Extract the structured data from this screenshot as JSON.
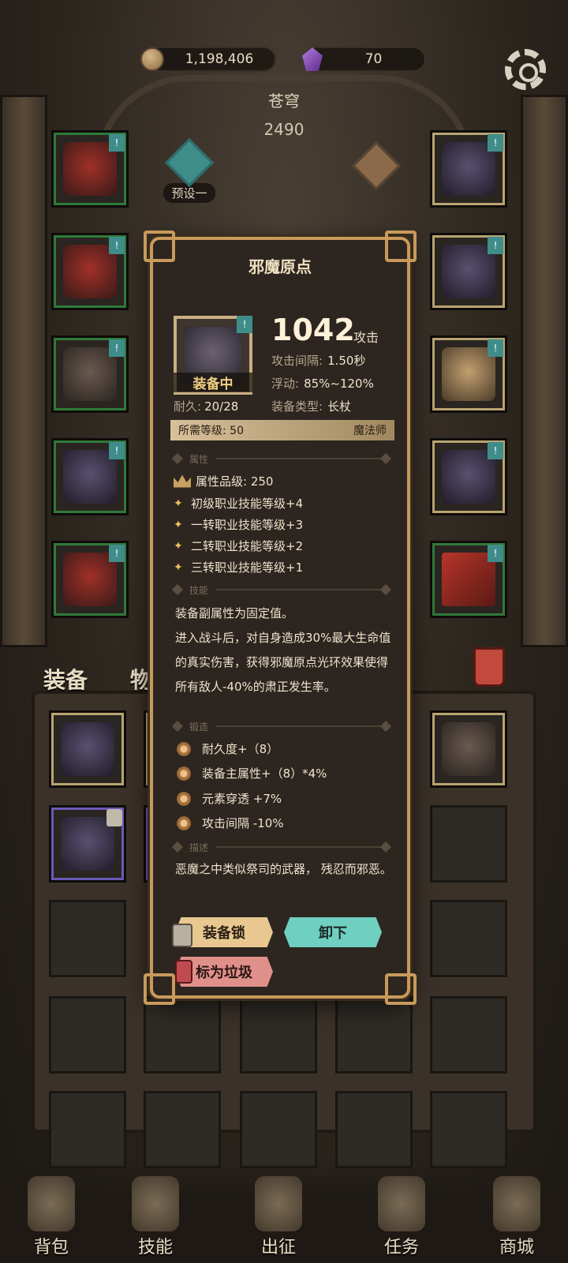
{
  "currency": {
    "gold": "1,198,406",
    "gems": "70"
  },
  "character": {
    "name": "苍穹",
    "power": "2490"
  },
  "preset": {
    "label": "预设一"
  },
  "bag_tabs": [
    "装备",
    "物品"
  ],
  "nav": [
    "背包",
    "技能",
    "出征",
    "任务",
    "商城"
  ],
  "item": {
    "name": "邪魔原点",
    "attack_value": "1042",
    "attack_label": "攻击",
    "equipped_label": "装备中",
    "durability_label": "耐久:",
    "durability_value": "20/28",
    "stats": [
      {
        "key": "攻击间隔:",
        "value": "1.50秒"
      },
      {
        "key": "浮动:",
        "value": "85%~120%"
      },
      {
        "key": "装备类型:",
        "value": "长杖"
      }
    ],
    "required_level": "所需等级: 50",
    "class": "魔法师",
    "tag_symbol": "!",
    "sections": {
      "attributes": "属性",
      "skill": "技能",
      "forge": "锻造",
      "description": "描述"
    },
    "attribute_grade": "属性品级: 250",
    "attributes": [
      "初级职业技能等级+4",
      "一转职业技能等级+3",
      "二转职业技能等级+2",
      "三转职业技能等级+1"
    ],
    "skill_text_1": "装备副属性为固定值。",
    "skill_text_2": "进入战斗后，对自身造成30%最大生命值的真实伤害，获得邪魔原点光环效果使得所有敌人-40%的肃正发生率。",
    "forge": [
      "耐久度+（8）",
      "装备主属性+（8）*4%",
      "元素穿透 +7%",
      "攻击间隔 -10%"
    ],
    "description": "恶魔之中类似祭司的武器， 残忍而邪恶。",
    "buttons": {
      "lock": "装备锁",
      "unequip": "卸下",
      "junk": "标为垃圾"
    }
  }
}
